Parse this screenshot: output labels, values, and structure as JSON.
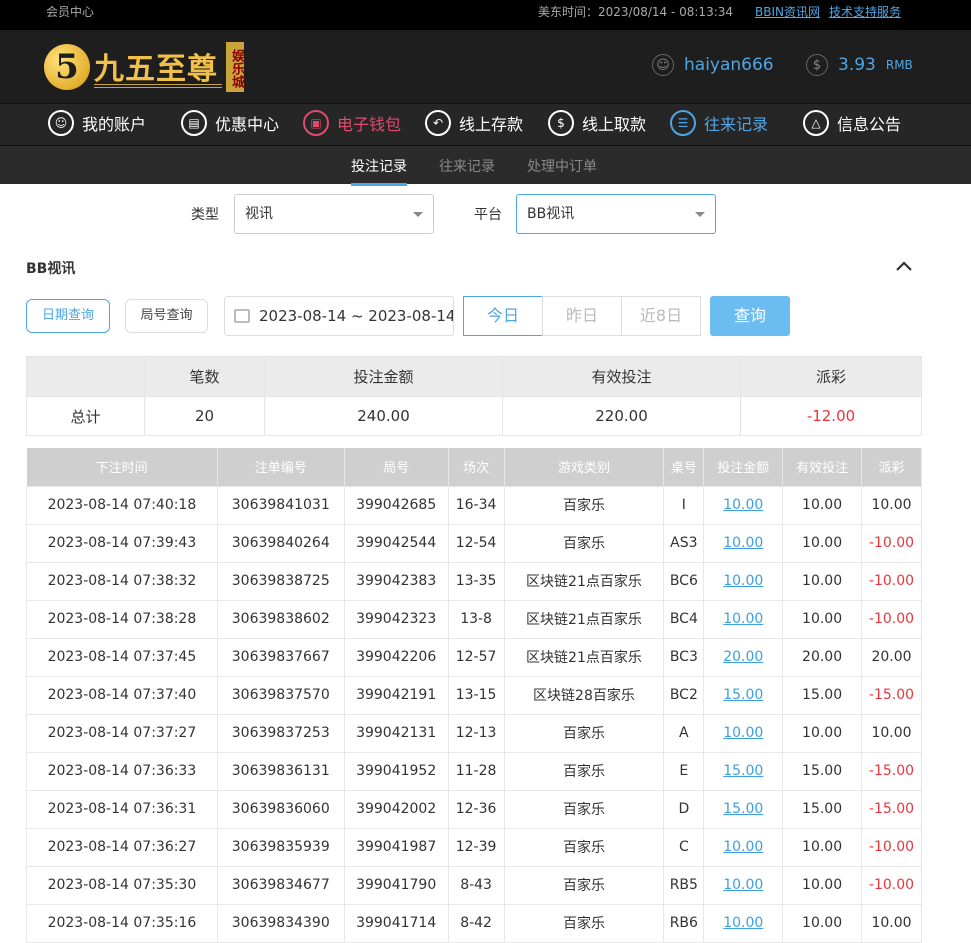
{
  "topbar": {
    "member_center": "会员中心",
    "time": "美东时间：2023/08/14 - 08:13:34",
    "link1": "BBIN资讯网",
    "link2": "技术支持服务"
  },
  "header": {
    "logo_number": "5",
    "logo_name": "九五至尊",
    "logo_badge": "娱乐城",
    "username": "haiyan666",
    "balance": "3.93",
    "currency": "RMB"
  },
  "nav": [
    {
      "label": "我的账户",
      "icon": "user-icon"
    },
    {
      "label": "优惠中心",
      "icon": "gift-icon"
    },
    {
      "label": "电子钱包",
      "icon": "wallet-icon"
    },
    {
      "label": "线上存款",
      "icon": "deposit-icon"
    },
    {
      "label": "线上取款",
      "icon": "withdraw-icon"
    },
    {
      "label": "往来记录",
      "icon": "record-icon"
    },
    {
      "label": "信息公告",
      "icon": "bell-icon"
    }
  ],
  "subnav": [
    "投注记录",
    "往来记录",
    "处理中订单"
  ],
  "filters": {
    "type_label": "类型",
    "type_value": "视讯",
    "platform_label": "平台",
    "platform_value": "BB视讯"
  },
  "section_title": "BB视讯",
  "query": {
    "date_query": "日期查询",
    "round_query": "局号查询",
    "date_range": "2023-08-14 ~ 2023-08-14",
    "today": "今日",
    "yesterday": "昨日",
    "last8": "近8日",
    "search": "查询"
  },
  "summary": {
    "headers": [
      "",
      "笔数",
      "投注金额",
      "有效投注",
      "派彩"
    ],
    "row": [
      "总计",
      "20",
      "240.00",
      "220.00",
      "-12.00"
    ]
  },
  "details": {
    "headers": [
      "下注时间",
      "注单编号",
      "局号",
      "场次",
      "游戏类别",
      "桌号",
      "投注金额",
      "有效投注",
      "派彩"
    ],
    "rows": [
      [
        "2023-08-14 07:40:18",
        "30639841031",
        "399042685",
        "16-34",
        "百家乐",
        "I",
        "10.00",
        "10.00",
        "10.00"
      ],
      [
        "2023-08-14 07:39:43",
        "30639840264",
        "399042544",
        "12-54",
        "百家乐",
        "AS3",
        "10.00",
        "10.00",
        "-10.00"
      ],
      [
        "2023-08-14 07:38:32",
        "30639838725",
        "399042383",
        "13-35",
        "区块链21点百家乐",
        "BC6",
        "10.00",
        "10.00",
        "-10.00"
      ],
      [
        "2023-08-14 07:38:28",
        "30639838602",
        "399042323",
        "13-8",
        "区块链21点百家乐",
        "BC4",
        "10.00",
        "10.00",
        "-10.00"
      ],
      [
        "2023-08-14 07:37:45",
        "30639837667",
        "399042206",
        "12-57",
        "区块链21点百家乐",
        "BC3",
        "20.00",
        "20.00",
        "20.00"
      ],
      [
        "2023-08-14 07:37:40",
        "30639837570",
        "399042191",
        "13-15",
        "区块链28百家乐",
        "BC2",
        "15.00",
        "15.00",
        "-15.00"
      ],
      [
        "2023-08-14 07:37:27",
        "30639837253",
        "399042131",
        "12-13",
        "百家乐",
        "A",
        "10.00",
        "10.00",
        "10.00"
      ],
      [
        "2023-08-14 07:36:33",
        "30639836131",
        "399041952",
        "11-28",
        "百家乐",
        "E",
        "15.00",
        "15.00",
        "-15.00"
      ],
      [
        "2023-08-14 07:36:31",
        "30639836060",
        "399042002",
        "12-36",
        "百家乐",
        "D",
        "15.00",
        "15.00",
        "-15.00"
      ],
      [
        "2023-08-14 07:36:27",
        "30639835939",
        "399041987",
        "12-39",
        "百家乐",
        "C",
        "10.00",
        "10.00",
        "-10.00"
      ],
      [
        "2023-08-14 07:35:30",
        "30639834677",
        "399041790",
        "8-43",
        "百家乐",
        "RB5",
        "10.00",
        "10.00",
        "-10.00"
      ],
      [
        "2023-08-14 07:35:16",
        "30639834390",
        "399041714",
        "8-42",
        "百家乐",
        "RB6",
        "10.00",
        "10.00",
        "10.00"
      ]
    ]
  },
  "colors": {
    "accent": "#4ea6e6",
    "negative": "#e8363c",
    "wallet_red": "#e04a6e",
    "gold": "#f1c04a"
  }
}
